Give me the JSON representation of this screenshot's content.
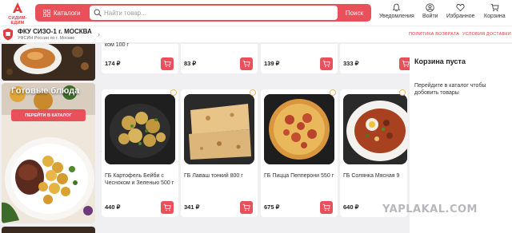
{
  "brand": {
    "logo_text": "СИДИМ-ЕДИМ",
    "accent": "#e8505a"
  },
  "search": {
    "catalog_label": "Каталоги",
    "placeholder": "Найти товар...",
    "button_label": "Поиск"
  },
  "header_actions": [
    {
      "label": "Уведомления",
      "icon": "bell-icon"
    },
    {
      "label": "Войти",
      "icon": "user-icon"
    },
    {
      "label": "Избранное",
      "icon": "heart-icon"
    },
    {
      "label": "Корзина",
      "icon": "cart-icon"
    }
  ],
  "store": {
    "name": "ФКУ СИЗО-1 г. МОСКВА",
    "subtitle": "УФСИН России по г. Москве"
  },
  "links": {
    "return_policy": "ПОЛИТИКА ВОЗВРАТА",
    "delivery_terms": "УСЛОВИЯ ДОСТАВКИ"
  },
  "banner": {
    "title": "Готовые блюда",
    "button_label": "ПЕРЕЙТИ В КАТАЛОГ"
  },
  "top_row": [
    {
      "name_tail": "ком 100 г",
      "price": "174 ₽"
    },
    {
      "name_tail": "",
      "price": "83 ₽"
    },
    {
      "name_tail": "",
      "price": "139 ₽"
    },
    {
      "name_tail": "",
      "price": "333 ₽"
    }
  ],
  "products": [
    {
      "name": "ГБ Картофель Бейби с Чесноком и Зеленью 500 г",
      "price": "440 ₽",
      "image": "potatoes"
    },
    {
      "name": "ГБ Лаваш тонкий 800 г",
      "price": "341 ₽",
      "image": "lavash"
    },
    {
      "name": "ГБ Пицца Пепперони 550 г",
      "price": "675 ₽",
      "image": "pizza"
    },
    {
      "name": "ГБ Солянка Мясная 9",
      "price": "640 ₽",
      "image": "soup"
    }
  ],
  "cart": {
    "empty_title": "Корзина пуста",
    "hint": "Перейдите в каталог чтобы добовить товары"
  },
  "watermark": "YAPLAKAL.COM"
}
